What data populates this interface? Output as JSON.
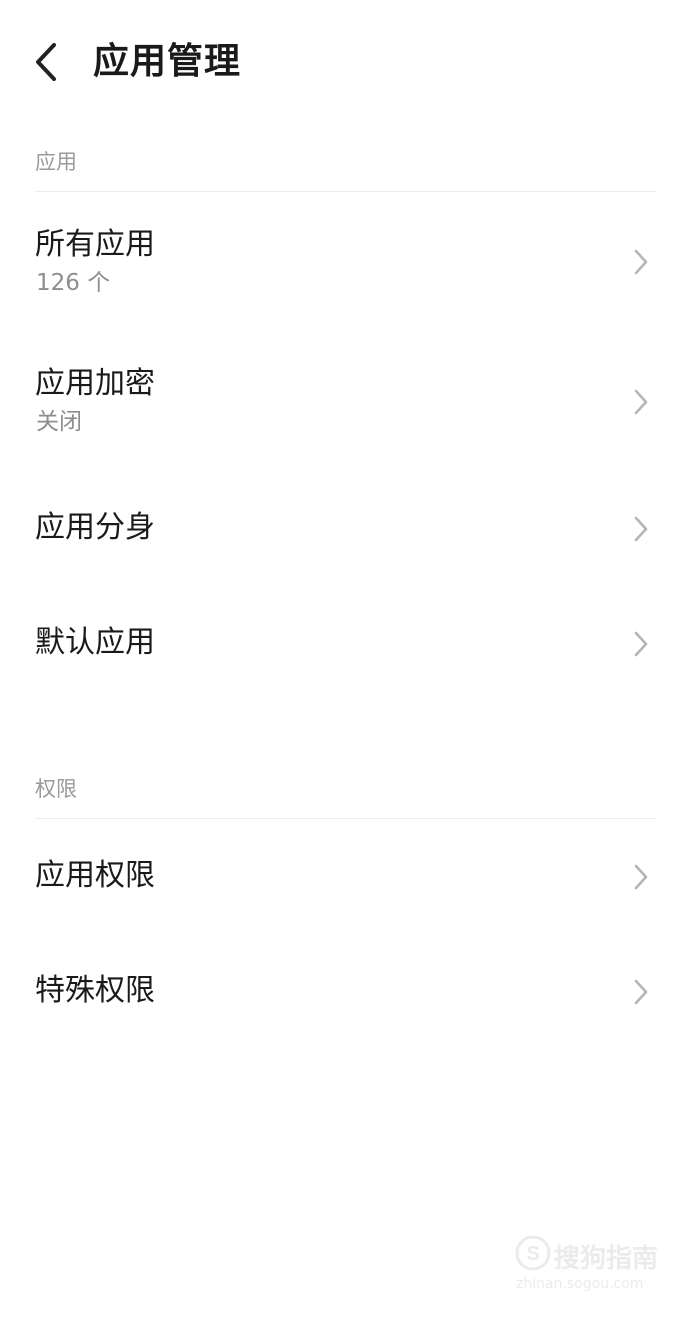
{
  "header": {
    "title": "应用管理",
    "back_icon": "chevron-left-icon"
  },
  "sections": [
    {
      "label": "应用",
      "items": [
        {
          "title": "所有应用",
          "subtitle": "126 个"
        },
        {
          "title": "应用加密",
          "subtitle": "关闭"
        },
        {
          "title": "应用分身"
        },
        {
          "title": "默认应用"
        }
      ]
    },
    {
      "label": "权限",
      "items": [
        {
          "title": "应用权限"
        },
        {
          "title": "特殊权限"
        }
      ]
    }
  ],
  "watermark": {
    "text": "搜狗指南",
    "url": "zhinan.sogou.com"
  },
  "colors": {
    "text_primary": "#1a1a1a",
    "text_secondary": "#8e8e8e",
    "section_label": "#9a9a9a",
    "chevron": "#b5b5b5",
    "divider": "#ebebeb",
    "background": "#ffffff"
  }
}
